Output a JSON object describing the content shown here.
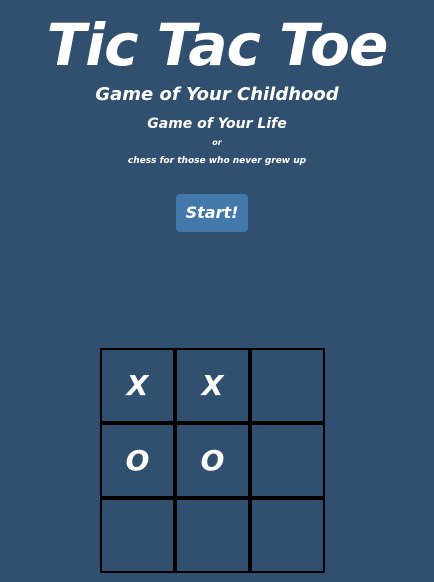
{
  "header": {
    "title": "Tic Tac Toe",
    "subtitle_1": "Game of Your Childhood",
    "subtitle_2": "Game of Your Life",
    "subtitle_3": "or",
    "subtitle_4": "chess for those who never grew up"
  },
  "controls": {
    "start_label": "Start!"
  },
  "board": {
    "cells": [
      "X",
      "X",
      "",
      "O",
      "O",
      "",
      "",
      "",
      ""
    ]
  },
  "colors": {
    "background": "#31506f",
    "button": "#4378ab",
    "grid_lines": "#000000",
    "text": "#ffffff"
  }
}
